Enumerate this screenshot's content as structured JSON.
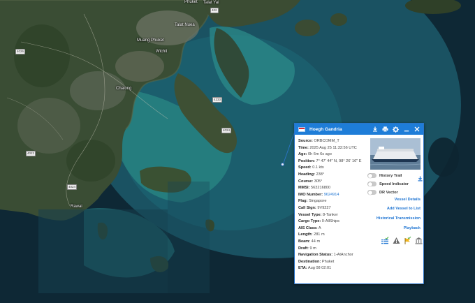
{
  "map": {
    "places": [
      "Phuket",
      "Talat Yai",
      "Talat Nuea",
      "Wichit",
      "Chalong",
      "Rawai",
      "Muang Phuket"
    ],
    "road_shields": [
      "4026",
      "402",
      "4022",
      "4024",
      "4233",
      "4024"
    ]
  },
  "popup": {
    "vessel_name": "Hoegh Gandria",
    "header_icons": [
      "download-icon",
      "print-icon",
      "gear-icon",
      "minimize-icon",
      "close-icon"
    ],
    "fields": [
      {
        "label": "Source:",
        "value": "ORBCOMM_T"
      },
      {
        "label": "Time:",
        "value": "2025 Aug 25 11:32:56 UTC"
      },
      {
        "label": "Age:",
        "value": "0h 6m 6s ago"
      },
      {
        "label": "Position:",
        "value": "7° 47' 44\" N, 98° 26' 16\" E"
      },
      {
        "label": "Speed:",
        "value": "0.1 kts"
      },
      {
        "label": "Heading:",
        "value": "238°"
      },
      {
        "label": "Course:",
        "value": "305°"
      },
      {
        "label": "MMSI:",
        "value": "563216800"
      },
      {
        "label": "IMO Number:",
        "value": "9624914",
        "link": true
      },
      {
        "label": "Flag:",
        "value": "Singapore"
      },
      {
        "label": "Call Sign:",
        "value": "9V9227"
      },
      {
        "label": "Vessel Type:",
        "value": "8-Tanker"
      },
      {
        "label": "Cargo Type:",
        "value": "0-AllShips"
      },
      {
        "label": "AIS Class:",
        "value": "A"
      },
      {
        "label": "Length:",
        "value": "281 m"
      },
      {
        "label": "Beam:",
        "value": "44 m"
      },
      {
        "label": "Draft:",
        "value": "9 m"
      },
      {
        "label": "Navigation Status:",
        "value": "1-AtAnchor"
      },
      {
        "label": "Destination:",
        "value": "Phuket"
      },
      {
        "label": "ETA:",
        "value": "Aug 08 02:01"
      }
    ],
    "toggles": {
      "history_trail": "History Trail",
      "speed_indicator": "Speed Indicator",
      "dr_vector": "DR Vector"
    },
    "links": {
      "vessel_details": "Vessel Details",
      "add_to_list": "Add Vessel to List",
      "historical_transmission": "Historical Transmission",
      "playback": "Playback"
    },
    "colors": {
      "header": "#1e7dd8",
      "link": "#1e74d2",
      "flag_red": "#e0262e"
    }
  }
}
